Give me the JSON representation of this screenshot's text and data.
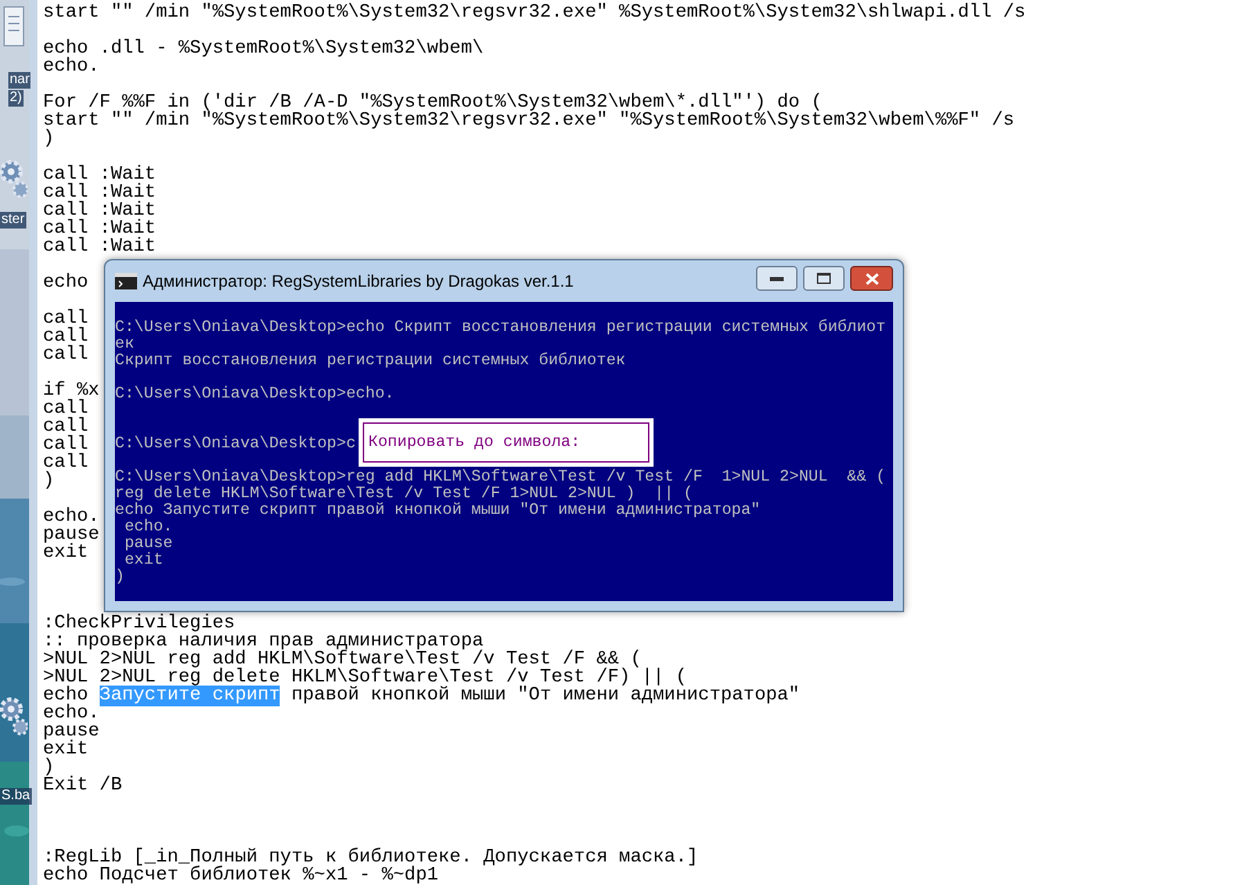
{
  "desktop": {
    "labels": [
      {
        "text": "nar"
      },
      {
        "text": "2)"
      },
      {
        "text": "ster"
      },
      {
        "text": "S.ba"
      }
    ]
  },
  "editor": {
    "upper_blocks": [
      {
        "lines": [
          {
            "text": "start \"\" /min \"%SystemRoot%\\System32\\regsvr32.exe\" %SystemRoot%\\System32\\shlwapi.dll /s"
          }
        ]
      },
      {
        "lines": [
          {
            "text": "echo .dll - %SystemRoot%\\System32\\wbem\\"
          },
          {
            "text": "echo."
          }
        ]
      },
      {
        "lines": [
          {
            "text": "For /F %%F in ('dir /B /A-D \"%SystemRoot%\\System32\\wbem\\*.dll\"') do ("
          },
          {
            "text": "start \"\" /min \"%SystemRoot%\\System32\\regsvr32.exe\" \"%SystemRoot%\\System32\\wbem\\%%F\" /s"
          },
          {
            "text": ")"
          }
        ]
      },
      {
        "lines": [
          {
            "text": "call :Wait"
          },
          {
            "text": "call :Wait"
          },
          {
            "text": "call :Wait"
          },
          {
            "text": "call :Wait"
          },
          {
            "text": "call :Wait"
          }
        ]
      },
      {
        "lines": [
          {
            "text": "echo"
          }
        ]
      },
      {
        "lines": [
          {
            "text": "call"
          },
          {
            "text": "call"
          },
          {
            "text": "call"
          }
        ]
      },
      {
        "lines": [
          {
            "text": "if %x"
          },
          {
            "text": "call"
          },
          {
            "text": "call"
          },
          {
            "text": "call"
          },
          {
            "text": "call"
          },
          {
            "text": ")"
          }
        ]
      },
      {
        "lines": [
          {
            "text": "echo."
          },
          {
            "text": "pause"
          },
          {
            "text": "exit"
          }
        ]
      }
    ],
    "lower_blocks": [
      {
        "lines": [
          {
            "text": ":CheckPrivilegies"
          },
          {
            "text": ":: проверка наличия прав администратора"
          },
          {
            "text": ">NUL 2>NUL reg add HKLM\\Software\\Test /v Test /F && ("
          },
          {
            "text": ">NUL 2>NUL reg delete HKLM\\Software\\Test /v Test /F) || ("
          },
          {
            "segments": [
              {
                "text": "echo ",
                "selected": false
              },
              {
                "text": "Запустите скрипт",
                "selected": true
              },
              {
                "text": " правой кнопкой мыши \"От имени администратора\"",
                "selected": false
              }
            ]
          },
          {
            "text": "echo."
          },
          {
            "text": "pause"
          },
          {
            "text": "exit"
          },
          {
            "text": ")"
          },
          {
            "text": "Exit /B"
          }
        ]
      },
      {
        "lines": [
          {
            "text": ":RegLib [_in_Полный путь к библиотеке. Допускается маска.]"
          },
          {
            "text": "echo Подсчет библиотек %~x1 - %~dp1"
          }
        ]
      }
    ]
  },
  "console": {
    "title": "Администратор:  RegSystemLibraries by Dragokas ver.1.1",
    "entries": [
      {
        "kind": "command",
        "lines": [
          "C:\\Users\\Oniava\\Desktop>echo Скрипт восстановления регистрации системных библиот",
          "ек",
          "Скрипт восстановления регистрации системных библиотек"
        ]
      },
      {
        "kind": "empty_echo",
        "lines": [
          "C:\\Users\\Oniava\\Desktop>echo."
        ]
      },
      {
        "kind": "command",
        "lines": [
          "C:\\Users\\Oniava\\Desktop>c"
        ]
      },
      {
        "kind": "command",
        "lines": [
          "C:\\Users\\Oniava\\Desktop>reg add HKLM\\Software\\Test /v Test /F  1>NUL 2>NUL  && (",
          "reg delete HKLM\\Software\\Test /v Test /F 1>NUL 2>NUL )  || (",
          "echo Запустите скрипт правой кнопкой мыши \"От имени администратора\"",
          " echo.",
          " pause",
          " exit",
          ")"
        ]
      }
    ],
    "mark_dialog": {
      "label": "Копировать до символа:"
    }
  }
}
